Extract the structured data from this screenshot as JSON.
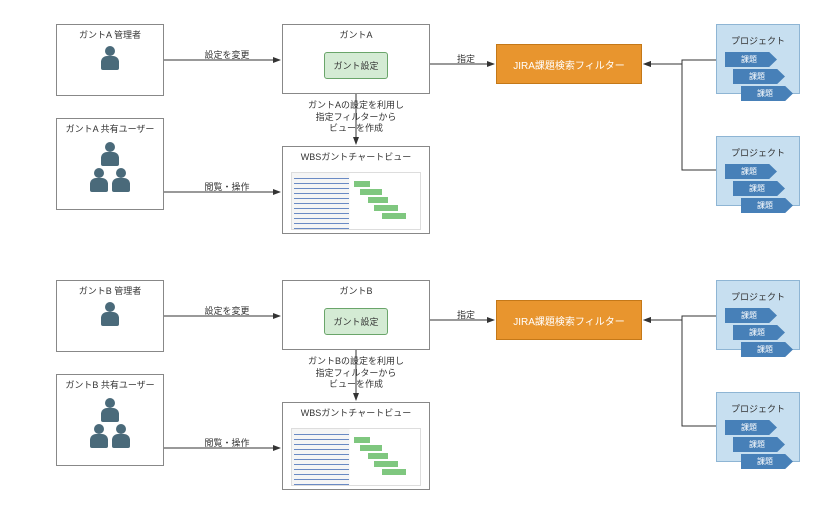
{
  "sectionA": {
    "adminTitle": "ガントA 管理者",
    "userTitle": "ガントA 共有ユーザー",
    "ganttBoxTitle": "ガントA",
    "settingsLabel": "ガント設定",
    "chartBoxTitle": "WBSガントチャートビュー",
    "edgeConfigChange": "設定を変更",
    "edgeViewOperate": "閲覧・操作",
    "edgeSpecify": "指定",
    "filterLabel": "JIRA課題検索フィルター",
    "midText": "ガントAの設定を利用し\n指定フィルターから\nビューを作成",
    "project1": {
      "title": "プロジェクト",
      "issues": [
        "課題",
        "課題",
        "課題"
      ]
    },
    "project2": {
      "title": "プロジェクト",
      "issues": [
        "課題",
        "課題",
        "課題"
      ]
    }
  },
  "sectionB": {
    "adminTitle": "ガントB 管理者",
    "userTitle": "ガントB 共有ユーザー",
    "ganttBoxTitle": "ガントB",
    "settingsLabel": "ガント設定",
    "chartBoxTitle": "WBSガントチャートビュー",
    "edgeConfigChange": "設定を変更",
    "edgeViewOperate": "閲覧・操作",
    "edgeSpecify": "指定",
    "filterLabel": "JIRA課題検索フィルター",
    "midText": "ガントBの設定を利用し\n指定フィルターから\nビューを作成",
    "project1": {
      "title": "プロジェクト",
      "issues": [
        "課題",
        "課題",
        "課題"
      ]
    },
    "project2": {
      "title": "プロジェクト",
      "issues": [
        "課題",
        "課題",
        "課題"
      ]
    }
  }
}
